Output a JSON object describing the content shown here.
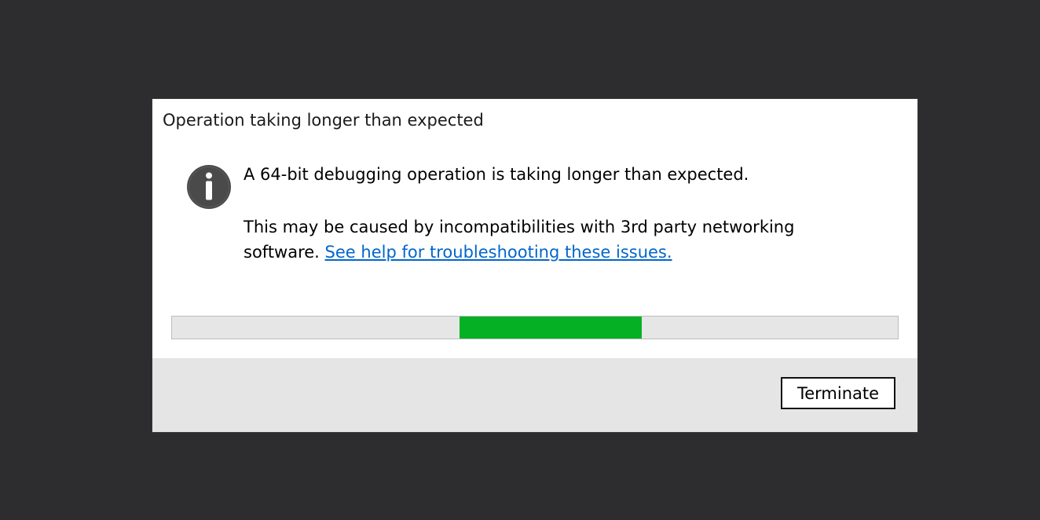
{
  "dialog": {
    "title": "Operation taking longer than expected",
    "icon": "info-icon",
    "message_primary": "A 64-bit debugging operation is taking longer than expected.",
    "message_secondary": "This may be caused by incompatibilities with 3rd party networking software.",
    "help_link": "See help for troubleshooting these issues.",
    "progress": {
      "mode": "indeterminate",
      "chunk_start_fraction": 0.396,
      "chunk_end_fraction": 0.647,
      "color": "#06b025"
    },
    "buttons": {
      "terminate_label": "Terminate"
    }
  },
  "colors": {
    "backdrop": "#2d2d2f",
    "dialog_bg": "#ffffff",
    "footer_bg": "#e5e5e5",
    "link": "#0066cc",
    "progress_track": "#e6e6e6",
    "progress_fill": "#06b025"
  }
}
